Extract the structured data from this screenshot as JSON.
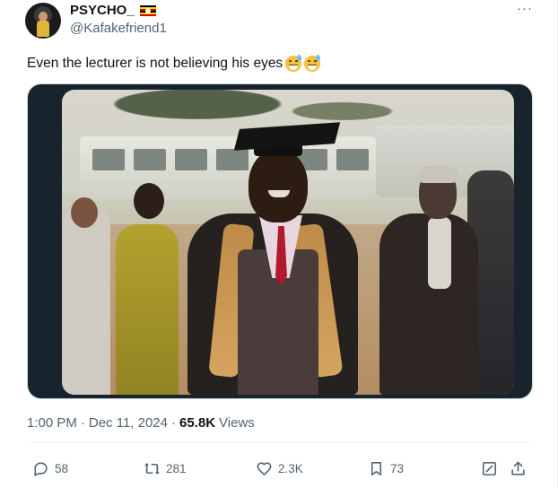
{
  "author": {
    "display_name": "PSYCHO_",
    "handle": "@Kafakefriend1",
    "flag_icon": "uganda-flag-icon",
    "flag_colors": [
      "#000000",
      "#fcdc04",
      "#d90000",
      "#000000",
      "#fcdc04",
      "#d90000"
    ]
  },
  "more_icon": "···",
  "tweet": {
    "text": "Even the lecturer is not believing his eyes",
    "emojis": [
      "grinning-sweat-emoji",
      "grinning-sweat-emoji"
    ]
  },
  "media": {
    "type": "video"
  },
  "meta": {
    "time": "1:00 PM",
    "separator": "·",
    "date": "Dec 11, 2024",
    "views_count": "65.8K",
    "views_label": "Views"
  },
  "actions": {
    "replies": "58",
    "retweets": "281",
    "likes": "2.3K",
    "bookmarks": "73"
  },
  "colors": {
    "text_primary": "#0f1419",
    "text_secondary": "#536471",
    "divider": "#eff3f4"
  }
}
